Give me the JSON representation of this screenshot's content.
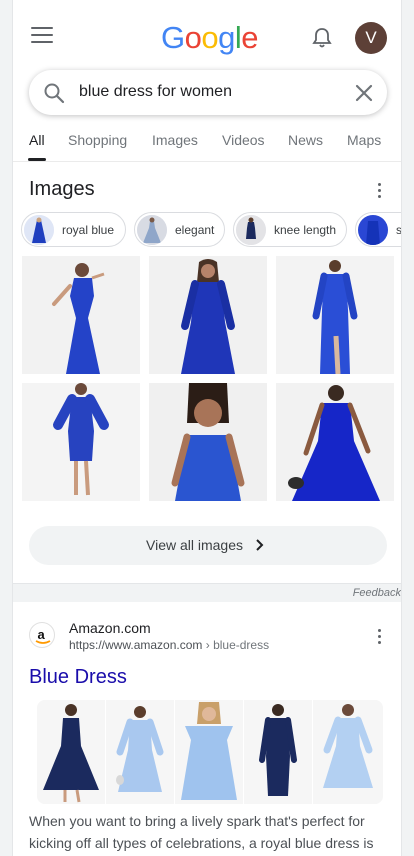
{
  "header": {
    "logo_letters": [
      {
        "ch": "G",
        "color": "#4285F4"
      },
      {
        "ch": "o",
        "color": "#EA4335"
      },
      {
        "ch": "o",
        "color": "#FBBC05"
      },
      {
        "ch": "g",
        "color": "#4285F4"
      },
      {
        "ch": "l",
        "color": "#34A853"
      },
      {
        "ch": "e",
        "color": "#EA4335"
      }
    ],
    "avatar_letter": "V",
    "avatar_color": "#5d4037"
  },
  "search": {
    "query": "blue dress for women"
  },
  "tabs": [
    "All",
    "Shopping",
    "Images",
    "Videos",
    "News",
    "Maps"
  ],
  "images_section": {
    "title": "Images",
    "chips": [
      "royal blue",
      "elegant",
      "knee length",
      "s"
    ],
    "view_all_label": "View all images",
    "feedback_label": "Feedback"
  },
  "result": {
    "site_name": "Amazon.com",
    "url": "https://www.amazon.com",
    "breadcrumb": "› blue-dress",
    "title": "Blue Dress",
    "snippet": "When you want to bring a lively spark that's perfect for kicking off all types of celebrations, a royal blue dress is"
  },
  "colors": {
    "link": "#1a0dab",
    "dress_royal": "#1f3fbf",
    "dress_navy": "#1b2a5e",
    "dress_light": "#a9c8ef"
  }
}
